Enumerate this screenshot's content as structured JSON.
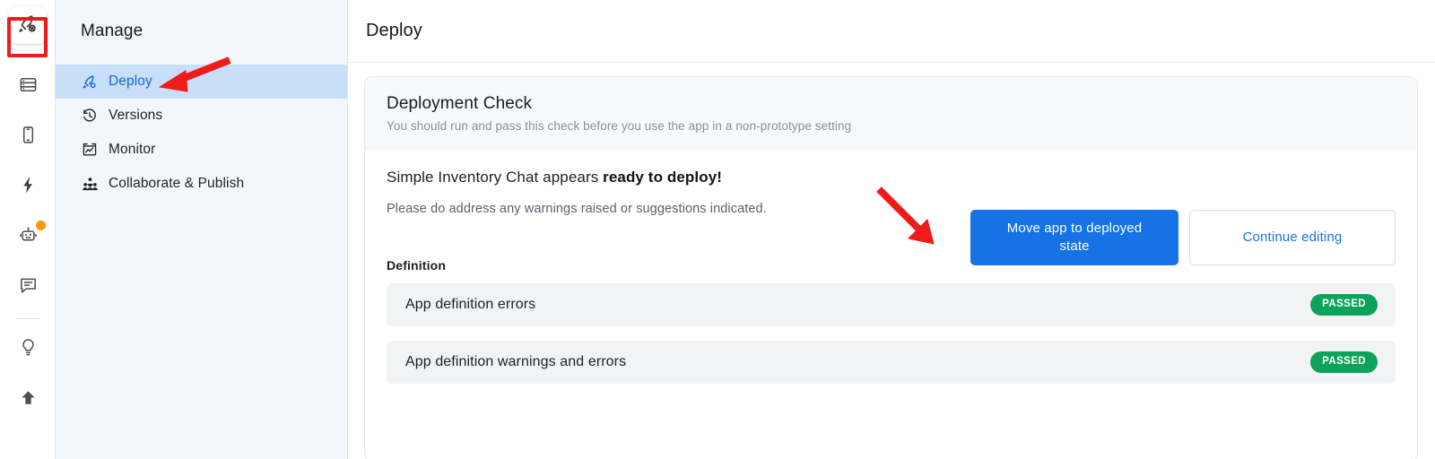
{
  "rail": {
    "items": [
      {
        "name": "deploy",
        "icon": "rocket-icon",
        "active": true,
        "badge": false
      },
      {
        "name": "data",
        "icon": "database-icon",
        "active": false,
        "badge": false
      },
      {
        "name": "device",
        "icon": "mobile-icon",
        "active": false,
        "badge": false
      },
      {
        "name": "actions",
        "icon": "lightning-icon",
        "active": false,
        "badge": false
      },
      {
        "name": "agent",
        "icon": "robot-icon",
        "active": false,
        "badge": true
      },
      {
        "name": "chat",
        "icon": "comment-icon",
        "active": false,
        "badge": false
      },
      {
        "name": "ideas",
        "icon": "lightbulb-icon",
        "active": false,
        "badge": false
      },
      {
        "name": "upload",
        "icon": "upload-icon",
        "active": false,
        "badge": false
      }
    ]
  },
  "sidebar": {
    "title": "Manage",
    "items": [
      {
        "label": "Deploy",
        "icon": "rocket-icon",
        "active": true
      },
      {
        "label": "Versions",
        "icon": "history-icon",
        "active": false
      },
      {
        "label": "Monitor",
        "icon": "monitor-icon",
        "active": false
      },
      {
        "label": "Collaborate & Publish",
        "icon": "people-icon",
        "active": false
      }
    ]
  },
  "main": {
    "title": "Deploy",
    "card": {
      "heading": "Deployment Check",
      "subheading": "You should run and pass this check before you use the app in a non-prototype setting",
      "status_prefix": "Simple Inventory Chat appears ",
      "status_emphasis": "ready to deploy!",
      "status_sub": "Please do address any warnings raised or suggestions indicated.",
      "primary_button": "Move app to deployed state",
      "secondary_button": "Continue editing",
      "section_label": "Definition",
      "checks": [
        {
          "name": "App definition errors",
          "status": "PASSED"
        },
        {
          "name": "App definition warnings and errors",
          "status": "PASSED"
        }
      ]
    }
  },
  "colors": {
    "accent_blue": "#1573e6",
    "link_blue": "#1a73e8",
    "pass_green": "#0ba25c",
    "annotation_red": "#ee1b1b",
    "sidebar_bg": "#f3f6fc",
    "sidebar_active": "#c9def9",
    "badge_orange": "#ff9800"
  }
}
